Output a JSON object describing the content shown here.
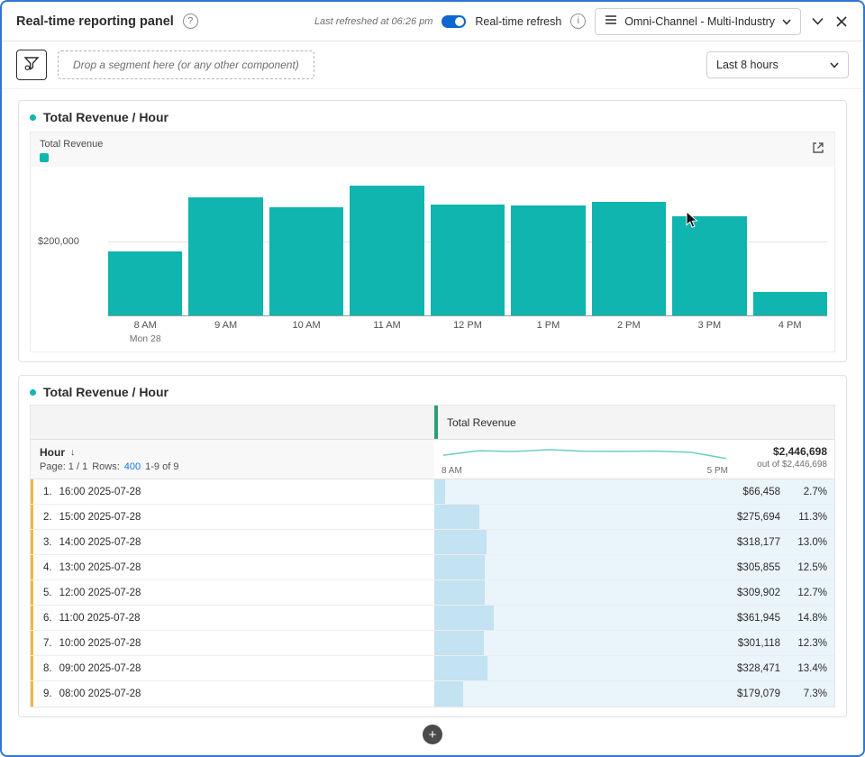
{
  "header": {
    "title": "Real-time reporting panel",
    "last_refreshed": "Last refreshed at 06:26 pm",
    "toggle_label": "Real-time refresh",
    "dataset_dropdown": "Omni-Channel - Multi-Industry"
  },
  "icons": {
    "help": "?",
    "info": "i"
  },
  "toolbar": {
    "drop_zone_hint": "Drop a segment here (or any other component)",
    "time_range": "Last 8 hours"
  },
  "chart_panel": {
    "title": "Total Revenue / Hour",
    "legend_label": "Total Revenue",
    "y_tick_label": "$200,000"
  },
  "chart_data": {
    "type": "bar",
    "title": "Total Revenue / Hour",
    "categories": [
      "8 AM",
      "9 AM",
      "10 AM",
      "11 AM",
      "12 PM",
      "1 PM",
      "2 PM",
      "3 PM",
      "4 PM"
    ],
    "secondary_labels": {
      "0": "Mon 28"
    },
    "values": [
      179079,
      328471,
      301118,
      361945,
      309902,
      305855,
      318177,
      275694,
      66458
    ],
    "xlabel": "Hour",
    "ylabel": "Total Revenue",
    "ymax": 400000,
    "gridline_value": 200000,
    "bar_color": "#0fb5ae",
    "legend_position": "top-left",
    "grid": true
  },
  "table_panel": {
    "title": "Total Revenue / Hour",
    "column_header": "Total Revenue",
    "dimension_header": "Hour",
    "sort_icon": "↓",
    "pagination": {
      "page": "Page: 1 / 1",
      "rows_label": "Rows:",
      "rows_value": "400",
      "range": "1-9 of 9"
    },
    "sparkline_start_label": "8 AM",
    "sparkline_end_label": "5 PM",
    "total_value": "$2,446,698",
    "total_caption": "out of $2,446,698",
    "rows": [
      {
        "index": "1.",
        "hour": "16:00 2025-07-28",
        "value": "$66,458",
        "percent": "2.7%"
      },
      {
        "index": "2.",
        "hour": "15:00 2025-07-28",
        "value": "$275,694",
        "percent": "11.3%"
      },
      {
        "index": "3.",
        "hour": "14:00 2025-07-28",
        "value": "$318,177",
        "percent": "13.0%"
      },
      {
        "index": "4.",
        "hour": "13:00 2025-07-28",
        "value": "$305,855",
        "percent": "12.5%"
      },
      {
        "index": "5.",
        "hour": "12:00 2025-07-28",
        "value": "$309,902",
        "percent": "12.7%"
      },
      {
        "index": "6.",
        "hour": "11:00 2025-07-28",
        "value": "$361,945",
        "percent": "14.8%"
      },
      {
        "index": "7.",
        "hour": "10:00 2025-07-28",
        "value": "$301,118",
        "percent": "12.3%"
      },
      {
        "index": "8.",
        "hour": "09:00 2025-07-28",
        "value": "$328,471",
        "percent": "13.4%"
      },
      {
        "index": "9.",
        "hour": "08:00 2025-07-28",
        "value": "$179,079",
        "percent": "7.3%"
      }
    ]
  },
  "footer": {
    "add_button_label": "+"
  },
  "colors": {
    "teal": "#0fb5ae",
    "toggle_blue": "#0e66d0",
    "link_blue": "#1473e6",
    "table_bar_fill": "#c3e2f2",
    "table_cell_tint": "#eaf4fb",
    "row_marker_yellow": "#f0b840",
    "column_marker_green": "#2d9d78",
    "frame_border": "#3177d2"
  }
}
